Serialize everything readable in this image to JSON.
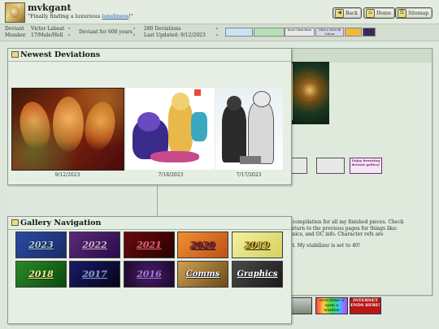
{
  "header": {
    "username": "mvkgant",
    "tagline_prefix": "\"Finally finding a luxurious ",
    "tagline_link": "loneliness",
    "tagline_suffix": "!\"",
    "buttons": [
      {
        "label": "Back",
        "icon": "back-arrow-icon"
      },
      {
        "label": "Home",
        "icon": "home-icon"
      },
      {
        "label": "Sitemap",
        "icon": "sitemap-icon"
      }
    ]
  },
  "infobar": {
    "role_line1": "Deviant",
    "role_line2": "Member",
    "name": "Victor Labeat",
    "details": "17/Male/Hell",
    "tenure": "Deviant for 600 years",
    "deviations": "280 Deviations",
    "last_updated": "Last Updated: 9/12/2023",
    "stamps": [
      {
        "name": "stamp-1",
        "bg": "#c8e4f4"
      },
      {
        "name": "stamp-2",
        "bg": "#b8e0b8"
      },
      {
        "name": "stamp-3",
        "bg": "#a84ab8"
      },
      {
        "name": "stamp-4",
        "bg": "#e8e8e8",
        "text": "Don't Click Here"
      },
      {
        "name": "stamp-5",
        "bg": "#d8d8e8",
        "text": "1000 x 1000 Hi Colour"
      },
      {
        "name": "stamp-6",
        "bg": "#f0b840"
      },
      {
        "name": "stamp-7",
        "bg": "#3a2a5a"
      }
    ]
  },
  "newest": {
    "title": "Newest Deviations",
    "items": [
      {
        "date": "9/12/2023"
      },
      {
        "date": "7/18/2023"
      },
      {
        "date": "7/17/2023"
      }
    ]
  },
  "gallery": {
    "title": "Gallery Navigation",
    "tiles": [
      {
        "label": "2023",
        "bg": "#2a3a8a",
        "color": "#9fd0ff"
      },
      {
        "label": "2022",
        "bg": "#4a1a6a",
        "color": "#d8a0f0"
      },
      {
        "label": "2021",
        "bg": "#5a0a0a",
        "color": "#ff5060"
      },
      {
        "label": "2020",
        "bg": "#d8781a",
        "color": "#a02020"
      },
      {
        "label": "2019",
        "bg": "#e8e070",
        "color": "#e8c020"
      },
      {
        "label": "2018",
        "bg": "#1a6a1a",
        "color": "#e0ff80"
      },
      {
        "label": "2017",
        "bg": "#0a0a3a",
        "color": "#7f8fff"
      },
      {
        "label": "2016",
        "bg": "#3a0a4a",
        "color": "#b070ff"
      },
      {
        "label": "Comms",
        "bg": "#a07a30",
        "color": "#ffffff"
      },
      {
        "label": "Graphics",
        "bg": "#2a2a2a",
        "color": "#ffffff"
      }
    ]
  },
  "background_text": {
    "p1": "n compilation for all my finished pieces. Check",
    "p2": "Return to the previous pages for things like:",
    "p3": "omics, and OC info. Character refs are",
    "p4": "let. My stabilizer is set to 40!"
  },
  "background_buttons": [
    {
      "text": ""
    },
    {
      "text": ""
    },
    {
      "text": "Enjoy browsing deviant gallery!"
    }
  ],
  "bottom_stamps": [
    {
      "text": ""
    },
    {
      "text": "everytime u open a window"
    },
    {
      "text": "INTERNET ENDS HERE!"
    }
  ]
}
